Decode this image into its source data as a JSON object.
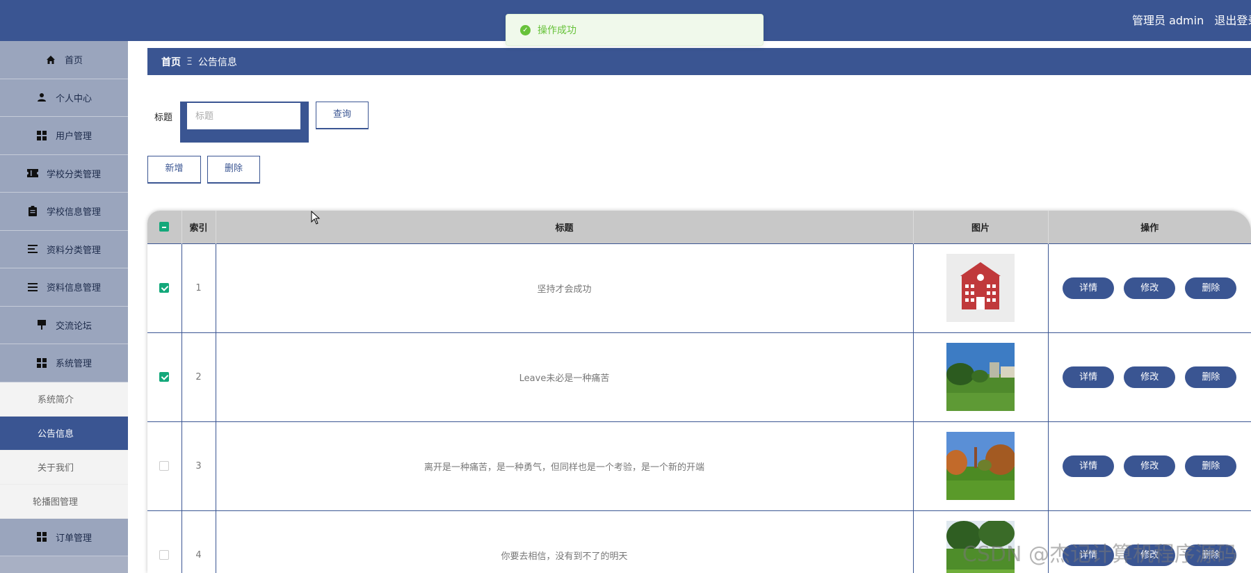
{
  "header": {
    "role": "管理员 admin",
    "logout": "退出登录"
  },
  "toast": {
    "message": "操作成功"
  },
  "sidebar": {
    "items": [
      {
        "label": "首页",
        "icon": "home-icon"
      },
      {
        "label": "个人中心",
        "icon": "user-icon"
      },
      {
        "label": "用户管理",
        "icon": "grid-icon"
      },
      {
        "label": "学校分类管理",
        "icon": "ticket-icon"
      },
      {
        "label": "学校信息管理",
        "icon": "clipboard-icon"
      },
      {
        "label": "资料分类管理",
        "icon": "list-icon"
      },
      {
        "label": "资料信息管理",
        "icon": "list-icon"
      },
      {
        "label": "交流论坛",
        "icon": "board-icon"
      },
      {
        "label": "系统管理",
        "icon": "grid-icon"
      }
    ],
    "sub_items": [
      {
        "label": "系统简介"
      },
      {
        "label": "公告信息",
        "active": true
      },
      {
        "label": "关于我们"
      },
      {
        "label": "轮播图管理"
      }
    ],
    "tail_item": {
      "label": "订单管理",
      "icon": "grid-icon"
    }
  },
  "breadcrumb": {
    "home": "首页",
    "separator": "Ξ",
    "current": "公告信息"
  },
  "search": {
    "label": "标题",
    "placeholder": "标题",
    "button": "查询"
  },
  "actions": {
    "add": "新增",
    "delete": "删除"
  },
  "table": {
    "headers": {
      "index": "索引",
      "title": "标题",
      "image": "图片",
      "ops": "操作"
    },
    "row_buttons": {
      "detail": "详情",
      "edit": "修改",
      "delete": "删除"
    },
    "rows": [
      {
        "index": "1",
        "title": "坚持才会成功",
        "checked": true,
        "image": "school-building-icon"
      },
      {
        "index": "2",
        "title": "Leave未必是一种痛苦",
        "checked": true,
        "image": "campus-photo"
      },
      {
        "index": "3",
        "title": "离开是一种痛苦，是一种勇气，但同样也是一个考验，是一个新的开端",
        "checked": false,
        "image": "campus-photo"
      },
      {
        "index": "4",
        "title": "你要去相信，没有到不了的明天",
        "checked": false,
        "image": "campus-photo"
      }
    ]
  },
  "watermark": "CSDN @杰记计算机程序源码",
  "colors": {
    "primary": "#3a5592",
    "success": "#67c23a",
    "checkbox": "#13a87a"
  }
}
